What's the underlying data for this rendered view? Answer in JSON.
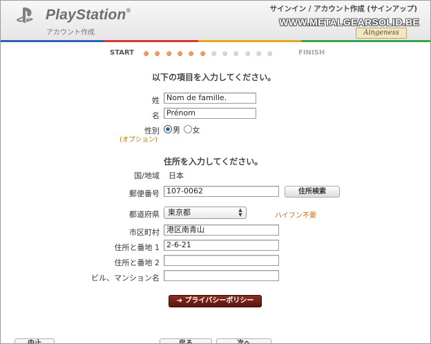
{
  "header": {
    "brand": "PlayStation",
    "brand_mark": "®",
    "subtitle": "アカウント作成",
    "title": "サインイン / アカウント作成 (サインアップ)",
    "watermark": "WWW.METALGEARSOLID.BE",
    "watermark_tag": "Aingeness",
    "logo_icon": "playstation-logo-icon"
  },
  "progress": {
    "start_label": "START",
    "finish_label": "FINISH",
    "total_steps": 12,
    "completed_steps": 6
  },
  "form": {
    "heading": "以下の項目を入力してください。",
    "last_name_label": "姓",
    "last_name_value": "Nom de famille.",
    "first_name_label": "名",
    "first_name_value": "Prénom",
    "gender_label": "性別",
    "gender_optional": "(オプション)",
    "gender_male": "男",
    "gender_female": "女",
    "gender_selected": "男"
  },
  "address": {
    "heading": "住所を入力してください。",
    "country_label": "国/地域",
    "country_value": "日本",
    "postal_label": "郵便番号",
    "postal_value": "107-0062",
    "search_button": "住所検索",
    "prefecture_label": "都道府県",
    "prefecture_value": "東京都",
    "hyphen_hint": "ハイフン不要",
    "city_label": "市区町村",
    "city_value": "港区南青山",
    "address1_label": "住所と番地 1",
    "address1_value": "2-6-21",
    "address2_label": "住所と番地 2",
    "address2_value": "",
    "building_label": "ビル、マンション名",
    "building_value": ""
  },
  "privacy_button": "➔ プライバシーポリシー",
  "bottom_buttons": [
    "中止",
    "戻る",
    "次へ"
  ],
  "colors": {
    "accent_orange": "#e0702c",
    "hint_orange": "#d06a0a",
    "privacy_button": "#6e1f17",
    "brand_bar": [
      "#2a5fb5",
      "#dd3333",
      "#e5a41c",
      "#3aa248"
    ]
  }
}
